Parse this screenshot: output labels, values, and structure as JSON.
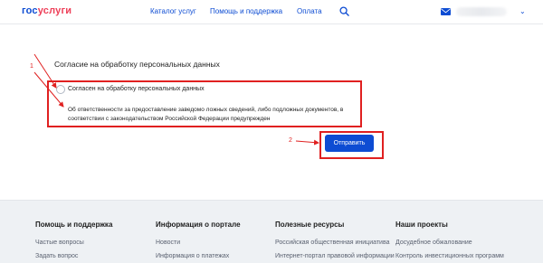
{
  "header": {
    "logo_part1": "гос",
    "logo_part2": "услуги",
    "nav": [
      "Каталог услуг",
      "Помощь и поддержка",
      "Оплата"
    ],
    "icons": {
      "search": "search-icon",
      "mail": "mail-icon",
      "chevron": "chevron-down-icon"
    },
    "user_chevron": "⌄"
  },
  "form": {
    "section_title": "Согласие на обработку персональных данных",
    "checkbox_label": "Согласен на обработку персональных данных",
    "disclaimer": "Об ответственности за предоставление заведомо ложных сведений, либо подложных документов, в соответствии с законодательством Российской Федерации предупрежден",
    "submit_label": "Отправить"
  },
  "annotations": {
    "marker1": "1",
    "marker2": "2",
    "color": "#e02020"
  },
  "footer": {
    "columns": [
      {
        "heading": "Помощь и поддержка",
        "links": [
          "Частые вопросы",
          "Задать вопрос"
        ]
      },
      {
        "heading": "Информация о портале",
        "links": [
          "Новости",
          "Информация о платежах"
        ]
      },
      {
        "heading": "Полезные ресурсы",
        "links": [
          "Российская общественная инициатива",
          "Интернет-портал правовой информации"
        ]
      },
      {
        "heading": "Наши проекты",
        "links": [
          "Досудебное обжалование",
          "Контроль инвестиционных программ"
        ]
      }
    ]
  },
  "colors": {
    "brand_blue": "#0d4cd3",
    "brand_red": "#ee3f58",
    "footer_bg": "#eef1f4"
  }
}
